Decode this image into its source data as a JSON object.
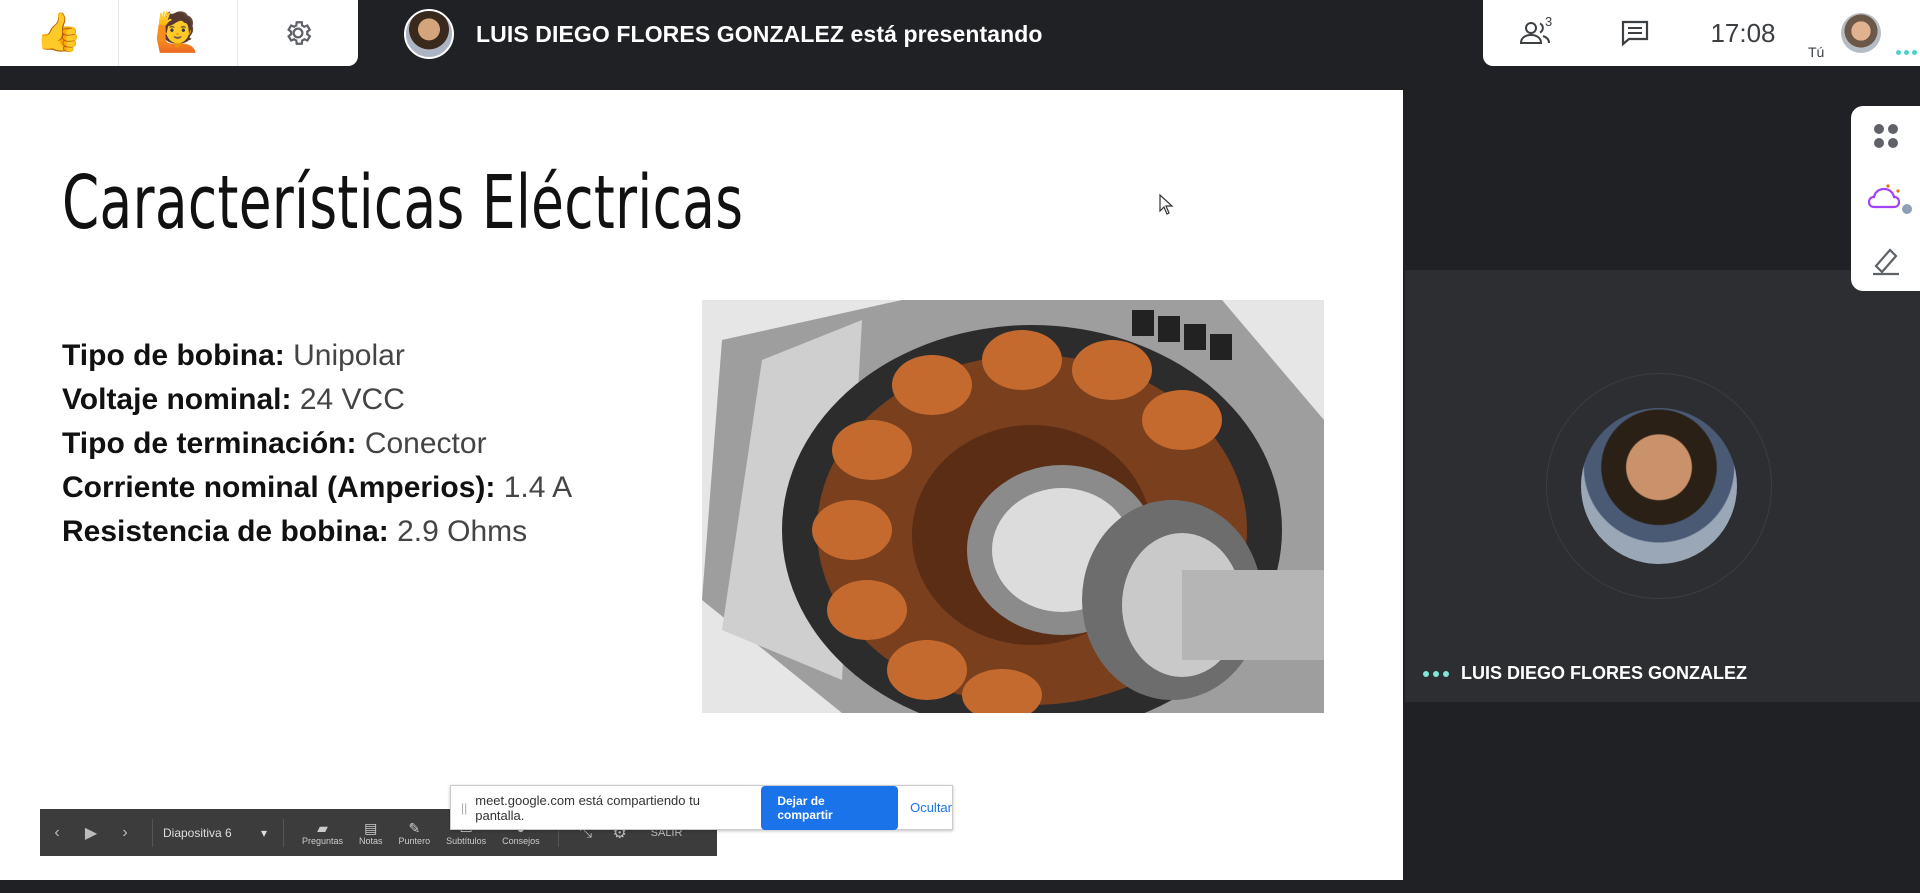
{
  "topbar": {
    "reactions": {
      "thumbs_up": "👍",
      "raise_hand": "🙋"
    },
    "presenter_text": "LUIS DIEGO FLORES GONZALEZ está presentando",
    "participant_count": "3",
    "clock": "17:08",
    "self_label": "Tú"
  },
  "slide": {
    "title": "Características Eléctricas",
    "specs": [
      {
        "label": "Tipo de bobina:",
        "value": "Unipolar"
      },
      {
        "label": "Voltaje nominal:",
        "value": "24 VCC"
      },
      {
        "label": "Tipo de terminación:",
        "value": "Conector"
      },
      {
        "label": "Corriente nominal (Amperios):",
        "value": "1.4 A"
      },
      {
        "label": "Resistencia de bobina:",
        "value": "2.9 Ohms"
      }
    ]
  },
  "slide_controls": {
    "slide_label": "Diapositiva 6",
    "items": [
      "Preguntas",
      "Notas",
      "Puntero",
      "Subtítulos",
      "Consejos"
    ],
    "exit": "SALIR"
  },
  "share_notice": {
    "text": "meet.google.com está compartiendo tu pantalla.",
    "stop_button": "Dejar de compartir",
    "hide_link": "Ocultar"
  },
  "participant_tile": {
    "name": "LUIS DIEGO FLORES GONZALEZ"
  },
  "colors": {
    "accent_blue": "#1a73e8",
    "background": "#202124",
    "tile_background": "#2d2e31",
    "speaking_dots": "#81e6d9"
  }
}
